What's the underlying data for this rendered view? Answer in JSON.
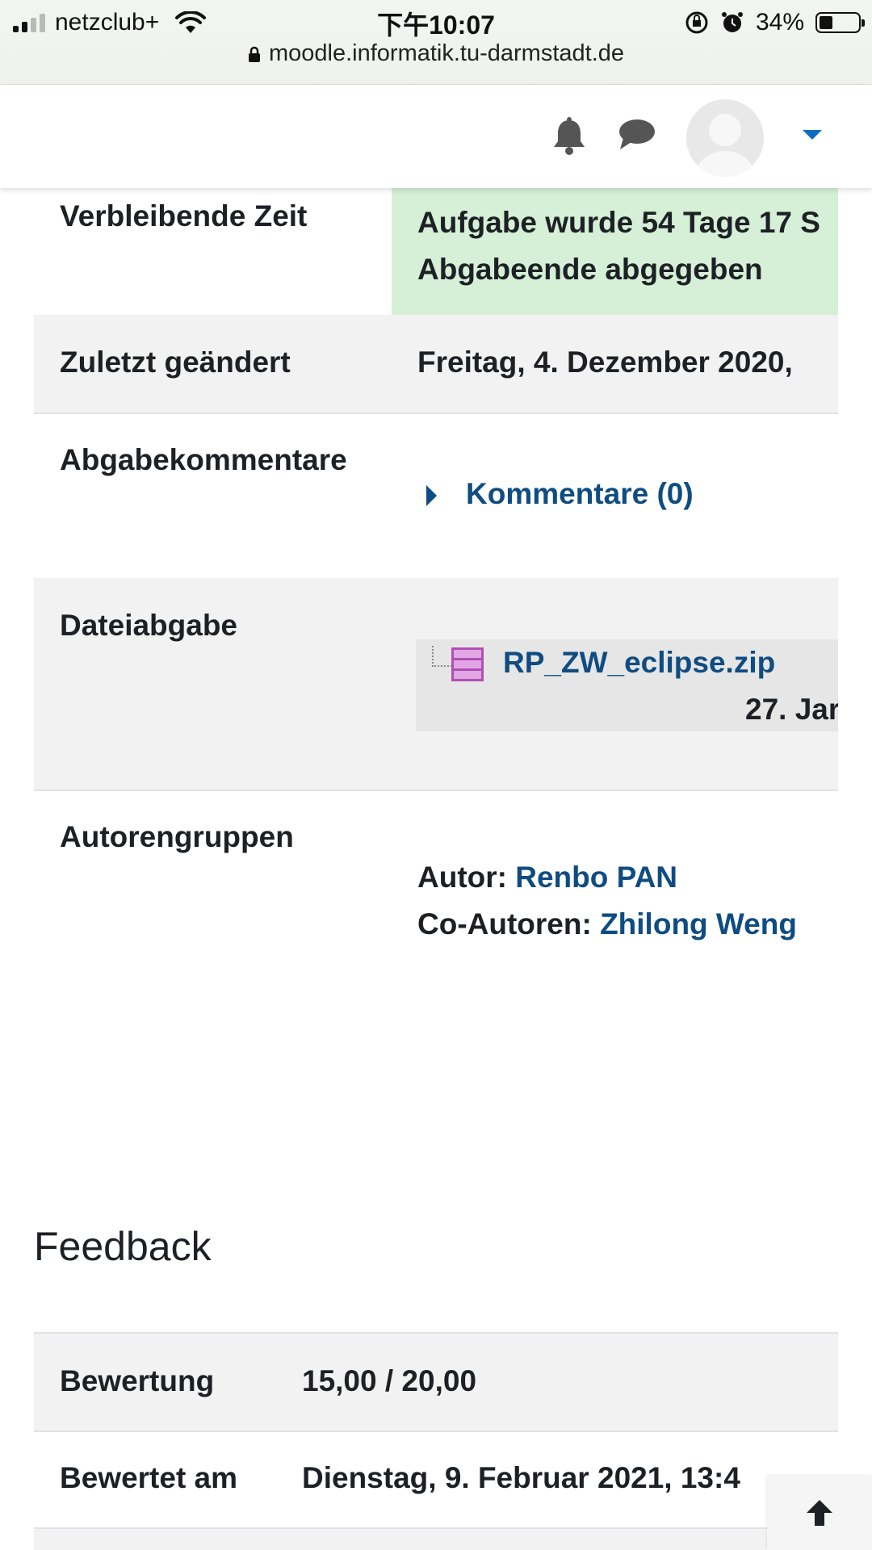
{
  "status_bar": {
    "carrier": "netzclub+",
    "time": "下午10:07",
    "battery_percent": "34%",
    "battery_level": 0.34,
    "url": "moodle.informatik.tu-darmstadt.de"
  },
  "navbar": {
    "icons": [
      "bell-icon",
      "chat-icon",
      "avatar",
      "chevron-down-icon"
    ]
  },
  "submission": {
    "remaining_time": {
      "label": "Verbleibende Zeit",
      "line1": "Aufgabe wurde 54 Tage 17 S",
      "line2": "Abgabeende abgegeben"
    },
    "last_modified": {
      "label": "Zuletzt geändert",
      "value": "Freitag, 4. Dezember 2020, "
    },
    "comments": {
      "label": "Abgabekommentare",
      "link": "Kommentare (0)"
    },
    "file": {
      "label": "Dateiabgabe",
      "filename": "RP_ZW_eclipse.zip",
      "date": "27. Jar"
    },
    "authors": {
      "label": "Autorengruppen",
      "author_prefix": "Autor:",
      "author": "Renbo PAN",
      "coauthor_prefix": "Co-Autoren:",
      "coauthor": "Zhilong Weng"
    }
  },
  "feedback": {
    "heading": "Feedback",
    "grade_label": "Bewertung",
    "grade_value": "15,00 / 20,00",
    "graded_on_label": "Bewertet am",
    "graded_on_value": "Dienstag, 9. Februar 2021, 13:4"
  },
  "colors": {
    "link": "#0f4c81",
    "success_bg": "#d5f0d7",
    "row_grey": "#f2f2f2"
  }
}
